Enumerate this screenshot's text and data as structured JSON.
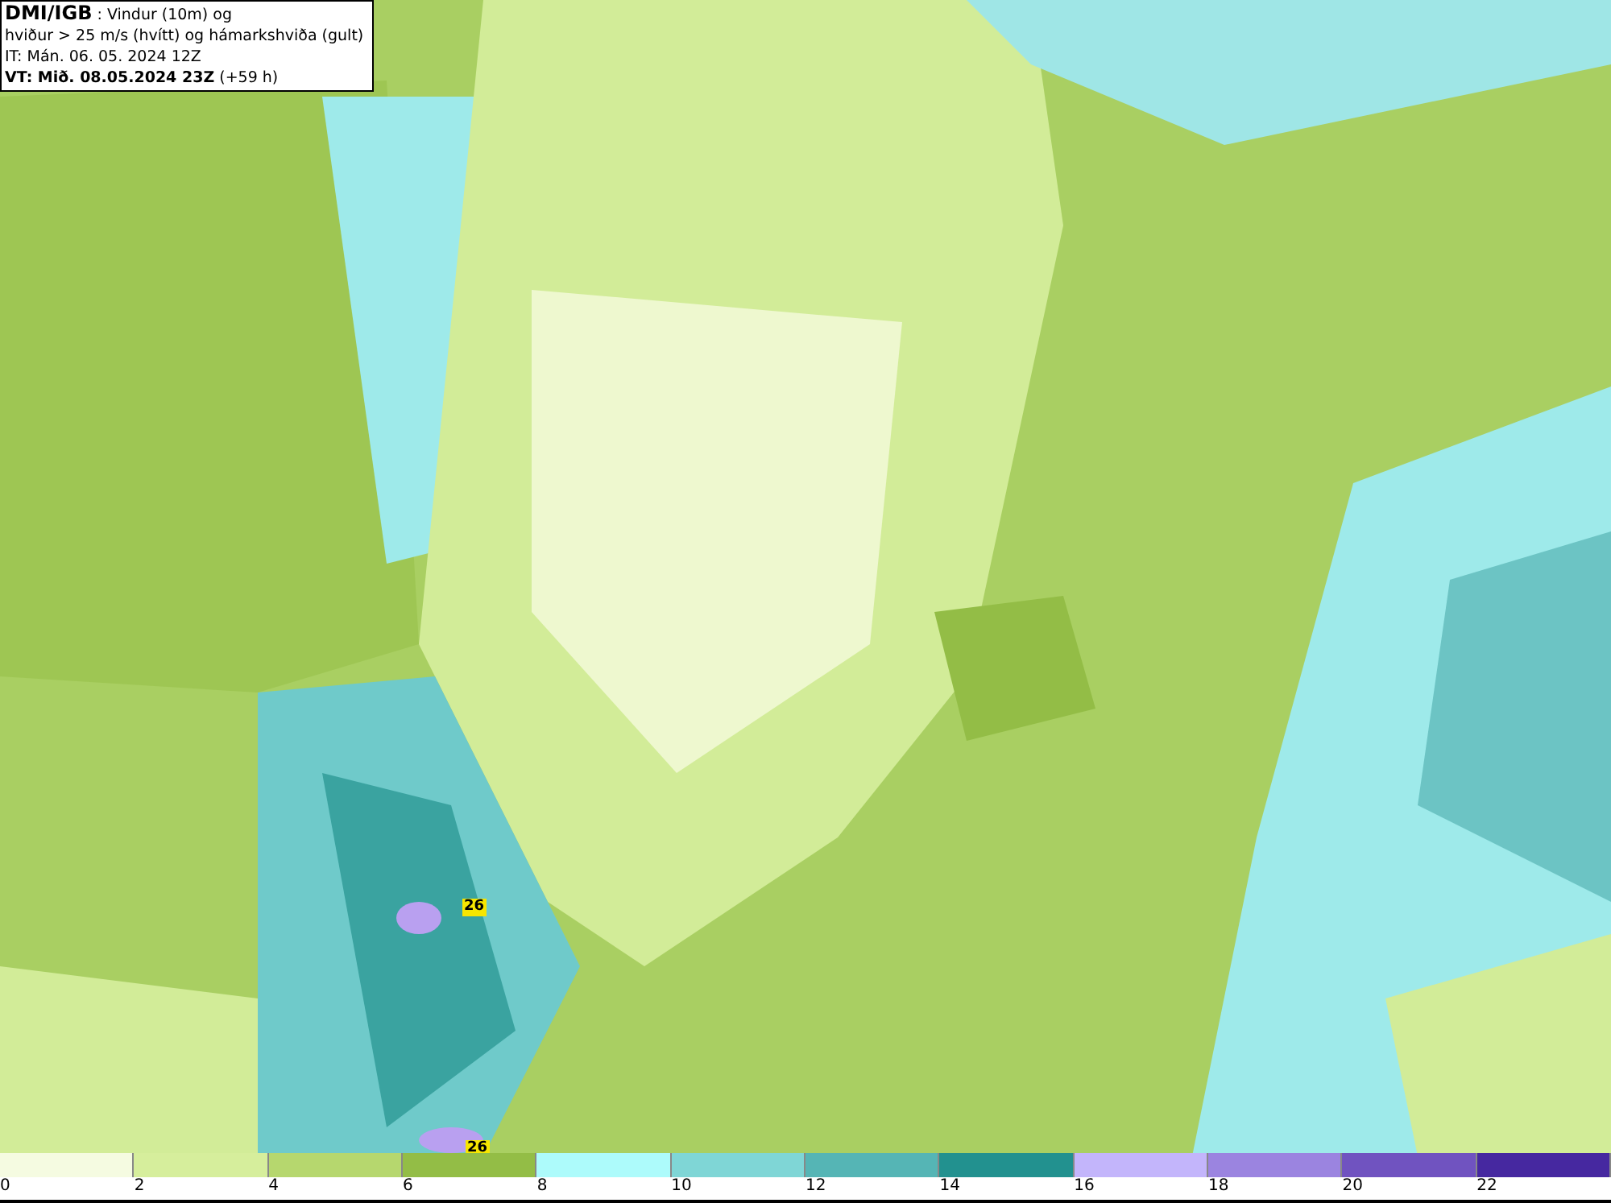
{
  "info": {
    "line1": "**DMI/IGB** : Vindur (10m) og",
    "line2": "hviður > 25 m/s (hvítt) og hámarkshviða (gult)",
    "line3": "IT: Mán. 06. 05. 2024 12Z",
    "line4": "**VT: Mið. 08.05.2024 23Z** (+59 h)"
  },
  "map": {
    "gust_markers": [
      {
        "value": "26"
      },
      {
        "value": "26"
      }
    ]
  },
  "legend": {
    "bins": [
      {
        "label": "0",
        "color": "#f5fbe1"
      },
      {
        "label": "2",
        "color": "#d6ee9c"
      },
      {
        "label": "4",
        "color": "#b6d76e"
      },
      {
        "label": "6",
        "color": "#93bd46"
      },
      {
        "label": "8",
        "color": "#adfbfb"
      },
      {
        "label": "10",
        "color": "#7fd6d6"
      },
      {
        "label": "12",
        "color": "#55b5b5"
      },
      {
        "label": "14",
        "color": "#22918f"
      },
      {
        "label": "16",
        "color": "#c3b5fb"
      },
      {
        "label": "18",
        "color": "#9b84e0"
      },
      {
        "label": "20",
        "color": "#7053c0"
      },
      {
        "label": "22",
        "color": "#4628a0"
      }
    ]
  }
}
